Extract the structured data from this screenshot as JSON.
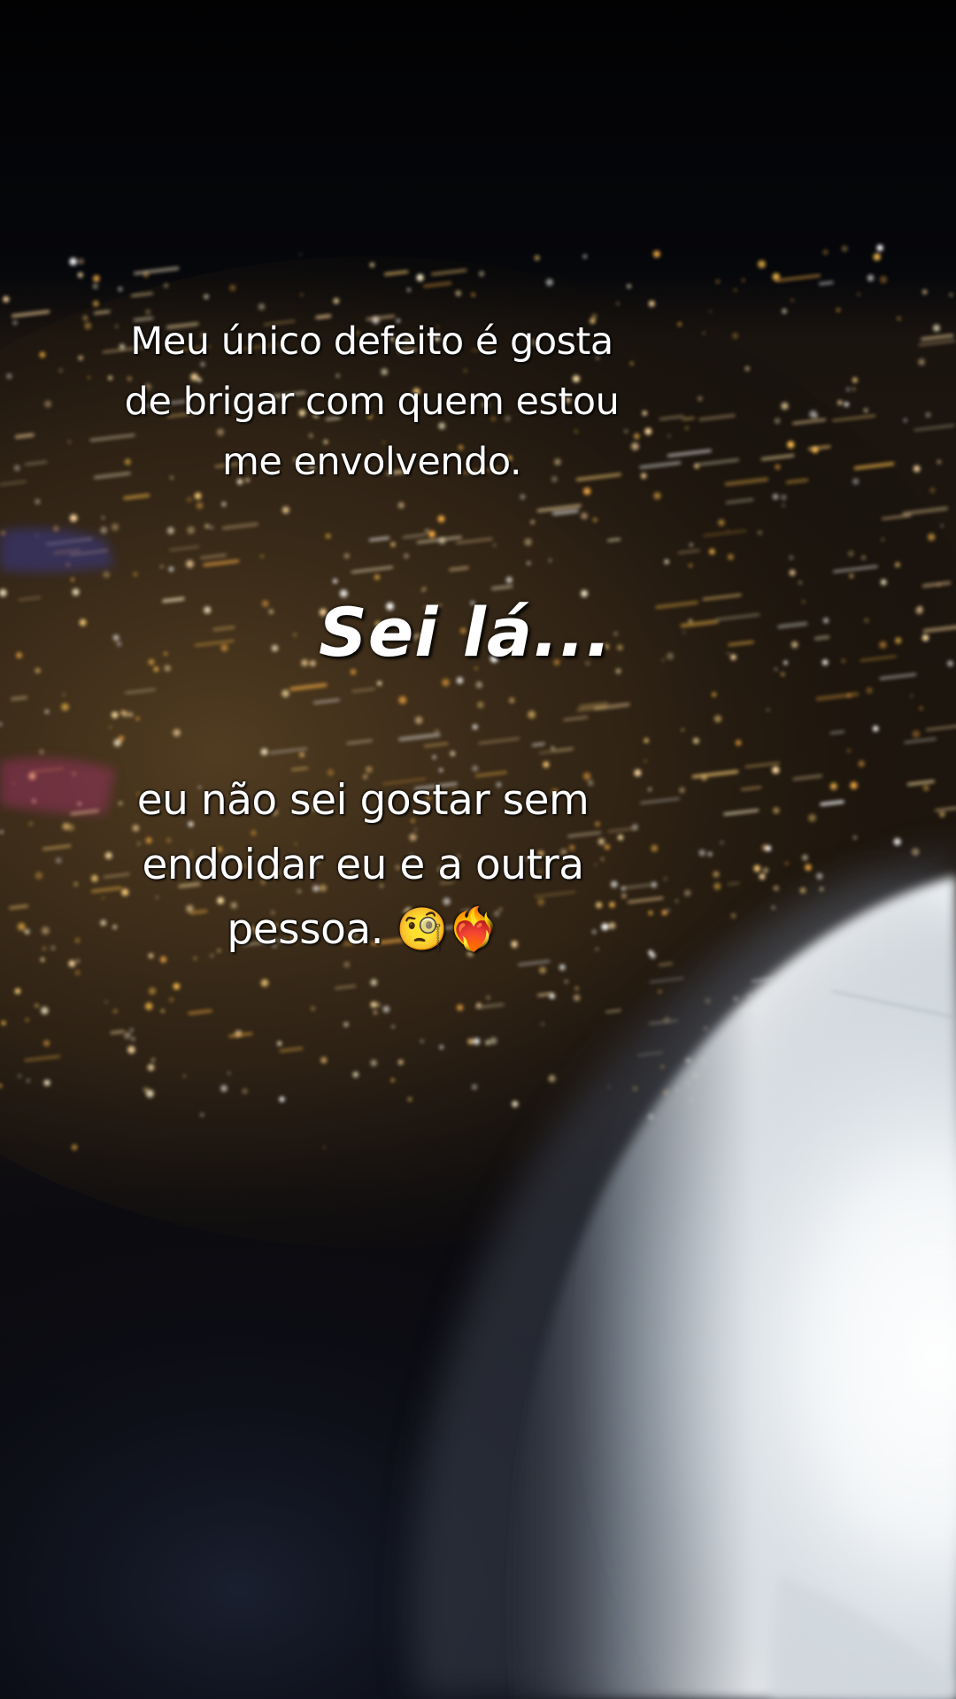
{
  "scene": {
    "description_icon": "airplane-window-night-city-icon",
    "colors": {
      "sky": "#05060a",
      "city_lights_warm": "#ffc857",
      "city_lights_white": "#ffffff",
      "engine_cowling": "#e9eef2"
    }
  },
  "captions": {
    "top": "Meu único defeito é gosta\nde brigar com quem estou\nme envolvendo.",
    "middle": "Sei lá...",
    "bottom": "eu não sei gostar sem\nendoidar eu e a outra\npessoa. 🧐❤️‍🔥"
  }
}
